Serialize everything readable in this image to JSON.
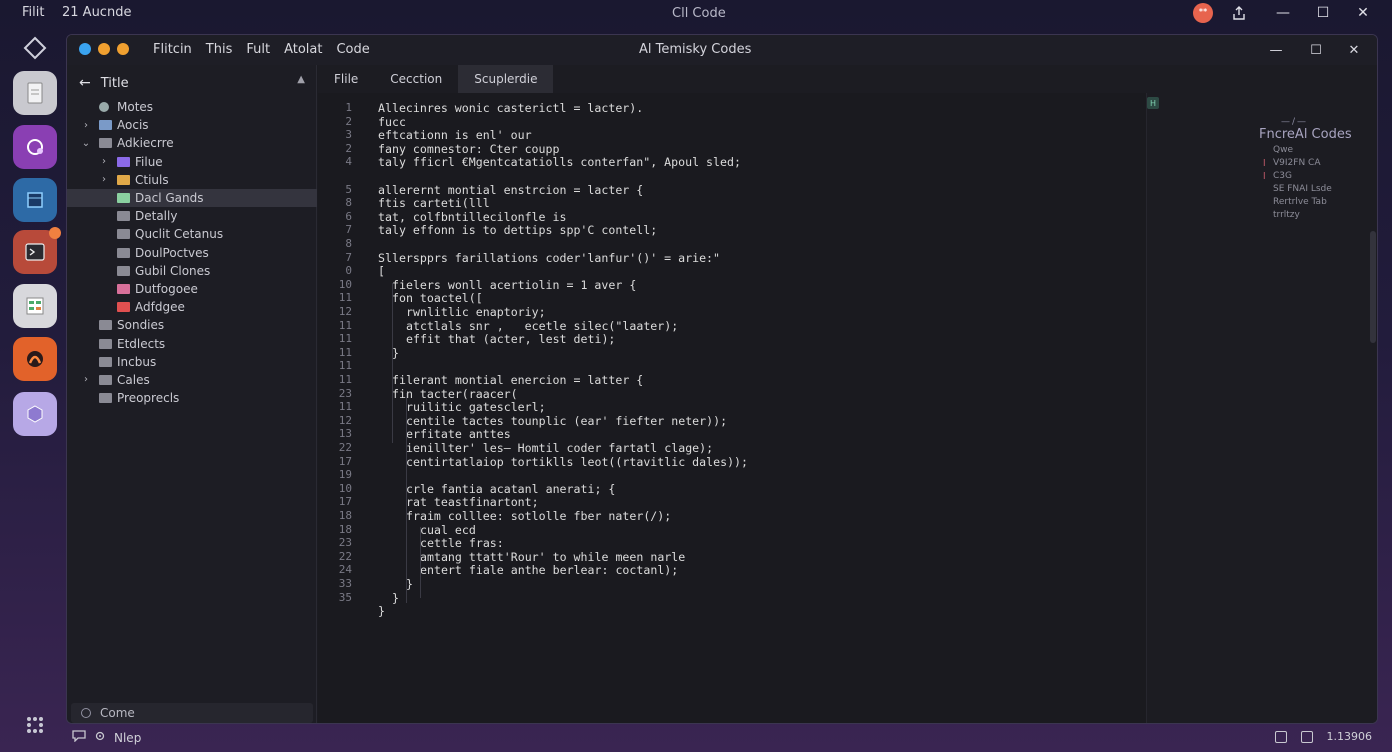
{
  "os_bar": {
    "menu1": "Filit",
    "menu2": "21 Aucnde",
    "title": "Cll Code",
    "badge_glyph": "ᕯ",
    "share_icon": "share-icon",
    "minimize": "—",
    "maximize": "☐",
    "close": "✕"
  },
  "dock": {
    "items": [
      {
        "name": "launcher-icon",
        "color": "#2a2a3a"
      },
      {
        "name": "document-app-icon",
        "color": "#c9c9cf"
      },
      {
        "name": "purple-app-icon",
        "color": "#8a3fb3"
      },
      {
        "name": "blue-cube-app-icon",
        "color": "#2d6aa6"
      },
      {
        "name": "terminal-app-icon",
        "color": "#b84a3a"
      },
      {
        "name": "spreadsheet-app-icon",
        "color": "#d8d8dc"
      },
      {
        "name": "orange-app-icon",
        "color": "#e2622a"
      },
      {
        "name": "lavender-app-icon",
        "color": "#b7a8e6"
      }
    ],
    "grid_icon": "grid-icon"
  },
  "window": {
    "title": "Al  Temisky Codes",
    "menu": [
      "Flitcin",
      "This",
      "Fult",
      "Atolat",
      "Code"
    ],
    "traffic_colors": [
      "#3aa3f0",
      "#f0a030",
      "#f0a030"
    ],
    "minimize": "—",
    "maximize": "☐",
    "close": "✕"
  },
  "sidebar": {
    "header": "Title",
    "tree": [
      {
        "label": "Motes",
        "depth": 0,
        "chev": "",
        "icon": "gear",
        "color": "#9aa"
      },
      {
        "label": "Aocis",
        "depth": 0,
        "chev": "›",
        "icon": "folder",
        "color": "#7a9ac8"
      },
      {
        "label": "Adkiecrre",
        "depth": 0,
        "chev": "⌄",
        "icon": "folder",
        "color": "#8a8a94"
      },
      {
        "label": "Filue",
        "depth": 1,
        "chev": "›",
        "icon": "folder",
        "color": "#8b6ae8"
      },
      {
        "label": "Ctiuls",
        "depth": 1,
        "chev": "›",
        "icon": "folder",
        "color": "#e0a848"
      },
      {
        "label": "Dacl Gands",
        "depth": 1,
        "chev": "",
        "icon": "folder",
        "color": "#8ad0a0",
        "selected": true
      },
      {
        "label": "Detally",
        "depth": 1,
        "chev": "",
        "icon": "folder",
        "color": "#8a8a94"
      },
      {
        "label": "Quclit Cetanus",
        "depth": 1,
        "chev": "",
        "icon": "folder",
        "color": "#8a8a94"
      },
      {
        "label": "DoulPoctves",
        "depth": 1,
        "chev": "",
        "icon": "folder",
        "color": "#8a8a94"
      },
      {
        "label": "Gubil Clones",
        "depth": 1,
        "chev": "",
        "icon": "folder",
        "color": "#8a8a94"
      },
      {
        "label": "Dutfogoee",
        "depth": 1,
        "chev": "",
        "icon": "folder",
        "color": "#d8709a"
      },
      {
        "label": "Adfdgee",
        "depth": 1,
        "chev": "",
        "icon": "folder",
        "color": "#e05050"
      },
      {
        "label": "Sondies",
        "depth": 0,
        "chev": "",
        "icon": "folder",
        "color": "#8a8a94"
      },
      {
        "label": "Etdlects",
        "depth": 0,
        "chev": "",
        "icon": "folder",
        "color": "#8a8a94"
      },
      {
        "label": "Incbus",
        "depth": 0,
        "chev": "",
        "icon": "folder",
        "color": "#8a8a94"
      },
      {
        "label": "Cales",
        "depth": 0,
        "chev": "›",
        "icon": "folder",
        "color": "#8a8a94"
      },
      {
        "label": "Preoprecls",
        "depth": 0,
        "chev": "",
        "icon": "folder",
        "color": "#8a8a94"
      }
    ],
    "footer": "Come"
  },
  "tabs": [
    "Flile",
    "Cecction",
    "Scuplerdie"
  ],
  "editor": {
    "lines": [
      {
        "n": "1",
        "indent": 0,
        "text": "Allecinres wonic casterictl = lacter)."
      },
      {
        "n": "2",
        "indent": 0,
        "text": "fucc"
      },
      {
        "n": "3",
        "indent": 0,
        "text": "eftcationn is enl' our"
      },
      {
        "n": "2",
        "indent": 0,
        "text": "fany comnestor: Cter coupp"
      },
      {
        "n": "4",
        "indent": 0,
        "text": "taly fficrl €Mgentcatatiolls conterfan\", Apoul sled;"
      },
      {
        "n": "",
        "indent": 0,
        "text": ""
      },
      {
        "n": "5",
        "indent": 0,
        "text": "allerernt montial enstrcion = lacter {"
      },
      {
        "n": "8",
        "indent": 0,
        "text": "ftis carteti(lll"
      },
      {
        "n": "6",
        "indent": 0,
        "text": "tat, colfbntillecilonfle is"
      },
      {
        "n": "7",
        "indent": 0,
        "text": "taly effonn is to dettips spp'C contell;"
      },
      {
        "n": "8",
        "indent": 0,
        "text": ""
      },
      {
        "n": "7",
        "indent": 0,
        "text": "Sllerspprs farillations coder'lanfur'()' = arie:\""
      },
      {
        "n": "0",
        "indent": 0,
        "text": "["
      },
      {
        "n": "10",
        "indent": 1,
        "text": "fielers wonll acertiolin = 1 aver {"
      },
      {
        "n": "11",
        "indent": 1,
        "text": "fon toactel(["
      },
      {
        "n": "12",
        "indent": 2,
        "text": "rwnlitlic enaptoriy;"
      },
      {
        "n": "11",
        "indent": 2,
        "text": "atctlals snr ,   ecetle silec(\"laater);"
      },
      {
        "n": "11",
        "indent": 2,
        "text": "effit that (acter, lest deti);"
      },
      {
        "n": "11",
        "indent": 1,
        "text": "}"
      },
      {
        "n": "11",
        "indent": 0,
        "text": ""
      },
      {
        "n": "11",
        "indent": 1,
        "text": "filerant montial enercion = latter {"
      },
      {
        "n": "23",
        "indent": 1,
        "text": "fin tacter(raacer("
      },
      {
        "n": "11",
        "indent": 2,
        "text": "ruilitic gatesclerl;"
      },
      {
        "n": "12",
        "indent": 2,
        "text": "centile tactes tounplic (ear' fiefter neter));"
      },
      {
        "n": "13",
        "indent": 2,
        "text": "erfitate anttes"
      },
      {
        "n": "22",
        "indent": 2,
        "text": "ienillter' les– Homtil coder fartatl clage);"
      },
      {
        "n": "17",
        "indent": 2,
        "text": "centirtatlaiop tortiklls leot((rtavitlic dales));"
      },
      {
        "n": "19",
        "indent": 0,
        "text": ""
      },
      {
        "n": "10",
        "indent": 2,
        "text": "crle fantia acatanl anerati; {"
      },
      {
        "n": "17",
        "indent": 2,
        "text": "rat teastfinartont;"
      },
      {
        "n": "18",
        "indent": 2,
        "text": "fraim colllee: sotlolle fber nater(/);"
      },
      {
        "n": "18",
        "indent": 3,
        "text": "cual ecd"
      },
      {
        "n": "23",
        "indent": 3,
        "text": "cettle fras:"
      },
      {
        "n": "22",
        "indent": 3,
        "text": "amtang ttatt'Rour' to while meen narle"
      },
      {
        "n": "24",
        "indent": 3,
        "text": "entert fiale anthe berlear: coctanl);"
      },
      {
        "n": "33",
        "indent": 2,
        "text": "}"
      },
      {
        "n": "35",
        "indent": 1,
        "text": "}"
      },
      {
        "n": "",
        "indent": 0,
        "text": "}"
      }
    ]
  },
  "right_panel": {
    "title": "FncreAl Codes",
    "dash": "—/—",
    "lines": [
      "Qwe",
      "V9I2FN CA",
      "C3G",
      "SE FNAI Lsde",
      "Rertrlve Tab",
      "trrltzy"
    ],
    "marks": [
      "l",
      "l"
    ]
  },
  "status": {
    "left_label": "Nlep",
    "right_text": "1.13906"
  }
}
